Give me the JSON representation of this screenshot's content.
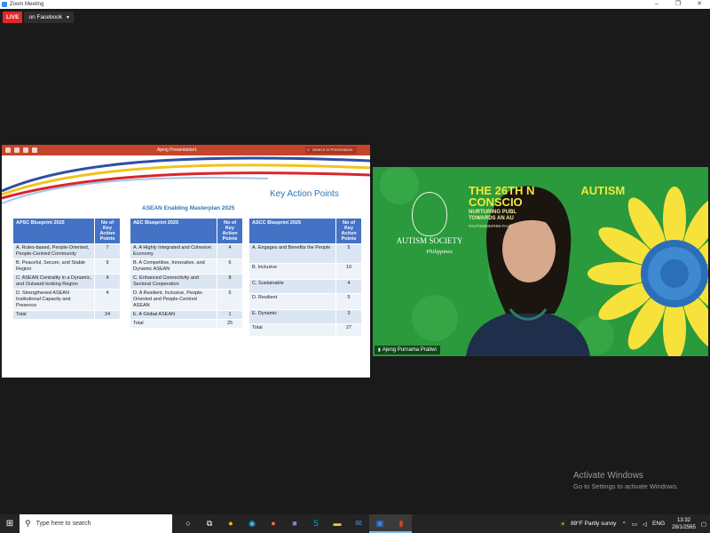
{
  "window": {
    "title": "Zoom Meeting",
    "controls": [
      "–",
      "❐",
      "✕"
    ]
  },
  "live": {
    "badge": "LIVE",
    "destination": "on Facebook"
  },
  "presentation": {
    "filename": "Ajeng Presentation1",
    "search_placeholder": "Search in Presentation",
    "slide": {
      "title": "Key Action Points",
      "subtitle": "ASEAN Enabling Masterplan 2025",
      "num_header": "No of Key Action Points",
      "apsc": {
        "header": "APSC Blueprint 2025",
        "rows": [
          {
            "label": "A. Rules-based, People-Oriented, People-Centred Community",
            "value": "7"
          },
          {
            "label": "B. Peaceful, Secure, and Stable Region",
            "value": "9"
          },
          {
            "label": "C. ASEAN Centrality in a Dynamic, and Outward-looking Region",
            "value": "4"
          },
          {
            "label": "D. Strengthened ASEAN Institutional Capacity and Presence",
            "value": "4"
          },
          {
            "label": "Total",
            "value": "24"
          }
        ]
      },
      "aec": {
        "header": "AEC Blueprint 2025",
        "rows": [
          {
            "label": "A. A Highly Integrated and Cohesive Economy",
            "value": "4"
          },
          {
            "label": "B. A Competitive, Innovative, and Dynamic ASEAN",
            "value": "6"
          },
          {
            "label": "C. Enhanced Connectivity and Sectoral Cooperation",
            "value": "8"
          },
          {
            "label": "D. A Resilient, Inclusive, People-Oriented and People-Centred ASEAN",
            "value": "6"
          },
          {
            "label": "E. A Global ASEAN",
            "value": "1"
          },
          {
            "label": "Total",
            "value": "25"
          }
        ]
      },
      "ascc": {
        "header": "ASCC Blueprint 2025",
        "rows": [
          {
            "label": "A. Engages and Benefits the People",
            "value": "5"
          },
          {
            "label": "B. Inclusive",
            "value": "10"
          },
          {
            "label": "C. Sustainable",
            "value": "4"
          },
          {
            "label": "D. Resilient",
            "value": "5"
          },
          {
            "label": "E. Dynamic",
            "value": "3"
          },
          {
            "label": "Total",
            "value": "27"
          }
        ]
      }
    }
  },
  "video": {
    "banner_title_1": "THE 26TH N",
    "banner_title_1b": "AUTISM",
    "banner_title_2": "CONSCIO",
    "banner_sub_1": "NURTURING PUBL",
    "banner_sub_2": "TOWARDS AN AU",
    "banner_hash": "#AUTISMOKPHM #AUT",
    "org_name": "AUTISM SOCIETY",
    "org_tag": "Philippines",
    "participant": "Ajeng Purnama Pratiwi"
  },
  "watermark": {
    "line1": "Activate Windows",
    "line2": "Go to Settings to activate Windows."
  },
  "taskbar": {
    "search_placeholder": "Type here to search",
    "weather": "89°F  Partly sunny",
    "lang": "ENG",
    "time": "13:32",
    "date": "28/1/2565"
  },
  "colors": {
    "live": "#e02828",
    "ppt_bar": "#c4452b",
    "table_header": "#4472c4",
    "banner_green": "#2a9a3c",
    "banner_yellow": "#f5e63a"
  }
}
